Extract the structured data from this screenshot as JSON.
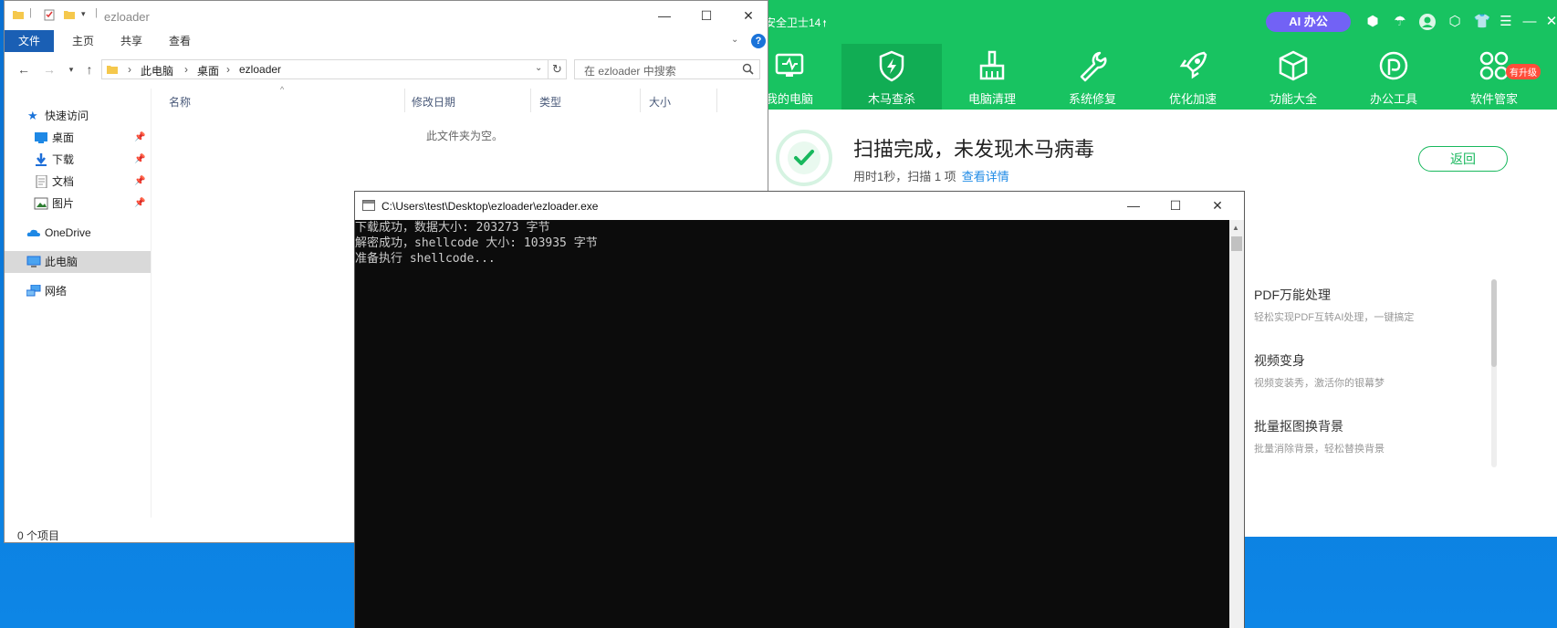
{
  "colors": {
    "accent_360": "#18c361",
    "file_tab": "#1a5fb4",
    "console_bg": "#0c0c0c",
    "ai_button": "#7262f5",
    "link": "#1e8ae6",
    "desktop": "#0a78d7"
  },
  "security_app": {
    "title": "安全卫士14",
    "ai_button": "AI 办公",
    "nav": [
      {
        "label": "我的电脑",
        "icon": "monitor-icon"
      },
      {
        "label": "木马查杀",
        "icon": "shield-icon",
        "active": true
      },
      {
        "label": "电脑清理",
        "icon": "broom-icon"
      },
      {
        "label": "系统修复",
        "icon": "wrench-icon"
      },
      {
        "label": "优化加速",
        "icon": "rocket-icon"
      },
      {
        "label": "功能大全",
        "icon": "cube-icon"
      },
      {
        "label": "办公工具",
        "icon": "office-icon"
      },
      {
        "label": "软件管家",
        "icon": "apps-icon"
      }
    ],
    "upgrade_badge": "有升级",
    "scan": {
      "title": "扫描完成，未发现木马病毒",
      "subtitle": "用时1秒，扫描 1 项",
      "details_link": "查看详情",
      "back_button": "返回"
    },
    "panel": [
      {
        "title": "PDF万能处理",
        "desc": "轻松实现PDF互转AI处理，一键搞定"
      },
      {
        "title": "视频变身",
        "desc": "视频变装秀，激活你的银幕梦"
      },
      {
        "title": "批量抠图换背景",
        "desc": "批量消除背景，轻松替换背景"
      }
    ]
  },
  "explorer": {
    "title": "ezloader",
    "ribbon_tabs": [
      "文件",
      "主页",
      "共享",
      "查看"
    ],
    "breadcrumb": [
      "此电脑",
      "桌面",
      "ezloader"
    ],
    "search_placeholder": "在 ezloader 中搜索",
    "sidebar": {
      "quick_access": "快速访问",
      "quick_items": [
        "桌面",
        "下载",
        "文档",
        "图片"
      ],
      "onedrive": "OneDrive",
      "this_pc": "此电脑",
      "network": "网络"
    },
    "columns": [
      "名称",
      "修改日期",
      "类型",
      "大小"
    ],
    "empty_message": "此文件夹为空。",
    "status": "0 个项目"
  },
  "console": {
    "title": "C:\\Users\\test\\Desktop\\ezloader\\ezloader.exe",
    "lines": [
      "下载成功，数据大小: 203273 字节",
      "解密成功，shellcode 大小: 103935 字节",
      "准备执行 shellcode..."
    ]
  }
}
